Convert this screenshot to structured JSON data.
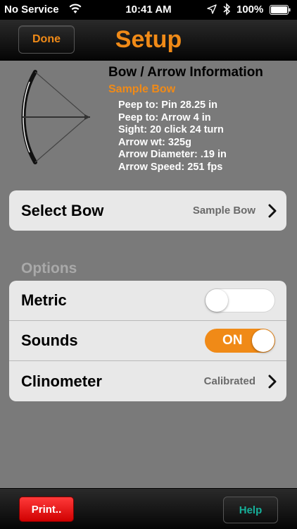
{
  "status_bar": {
    "carrier": "No Service",
    "time": "10:41 AM",
    "battery_percent": "100%",
    "icons": [
      "wifi-icon",
      "location-arrow-icon",
      "bluetooth-icon",
      "battery-icon"
    ]
  },
  "nav": {
    "title": "Setup",
    "done_label": "Done"
  },
  "bow_info": {
    "icon": "bow-arrow-icon",
    "title": "Bow / Arrow Information",
    "bow_name": "Sample Bow",
    "lines": [
      "Peep to: Pin 28.25 in",
      "Peep to: Arrow 4 in",
      "Sight: 20 click  24 turn",
      "Arrow wt: 325g",
      "Arrow Diameter: .19 in",
      "Arrow Speed: 251 fps"
    ]
  },
  "select_bow": {
    "label": "Select Bow",
    "value": "Sample Bow"
  },
  "options": {
    "header": "Options",
    "metric": {
      "label": "Metric",
      "state": "off"
    },
    "sounds": {
      "label": "Sounds",
      "state": "on",
      "on_text": "ON"
    },
    "clinometer": {
      "label": "Clinometer",
      "value": "Calibrated"
    }
  },
  "toolbar": {
    "print_label": "Print..",
    "help_label": "Help"
  },
  "colors": {
    "accent": "#f08a17",
    "background": "#7a7a7a",
    "print_red": "#e01010",
    "help_teal": "#16b09a"
  }
}
